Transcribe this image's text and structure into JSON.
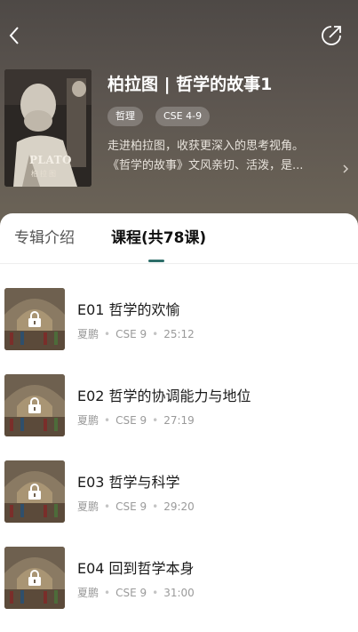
{
  "header": {
    "back_icon": "chevron-left-icon",
    "share_icon": "share-icon",
    "cover": {
      "title": "PLATO",
      "subtitle": "柏拉图"
    },
    "album_title": "柏拉图 | 哲学的故事1",
    "tags": [
      "哲理",
      "CSE 4-9"
    ],
    "description": [
      "走进柏拉图，收获更深入的思考视角。",
      "《哲学的故事》文风亲切、活泼，是..."
    ],
    "more_icon": "chevron-right-icon"
  },
  "tabs": [
    {
      "label": "专辑介绍",
      "active": false
    },
    {
      "label": "课程(共78课)",
      "active": true
    }
  ],
  "colors": {
    "accent": "#2e6e6a",
    "header_bg": "#5d5650"
  },
  "courses": [
    {
      "title": "E01 哲学的欢愉",
      "teacher": "夏鹏",
      "level": "CSE 9",
      "duration": "25:12",
      "icon": "lock-icon"
    },
    {
      "title": "E02 哲学的协调能力与地位",
      "teacher": "夏鹏",
      "level": "CSE 9",
      "duration": "27:19",
      "icon": "lock-icon"
    },
    {
      "title": "E03 哲学与科学",
      "teacher": "夏鹏",
      "level": "CSE 9",
      "duration": "29:20",
      "icon": "lock-icon"
    },
    {
      "title": "E04 回到哲学本身",
      "teacher": "夏鹏",
      "level": "CSE 9",
      "duration": "31:00",
      "icon": "lock-icon"
    }
  ]
}
